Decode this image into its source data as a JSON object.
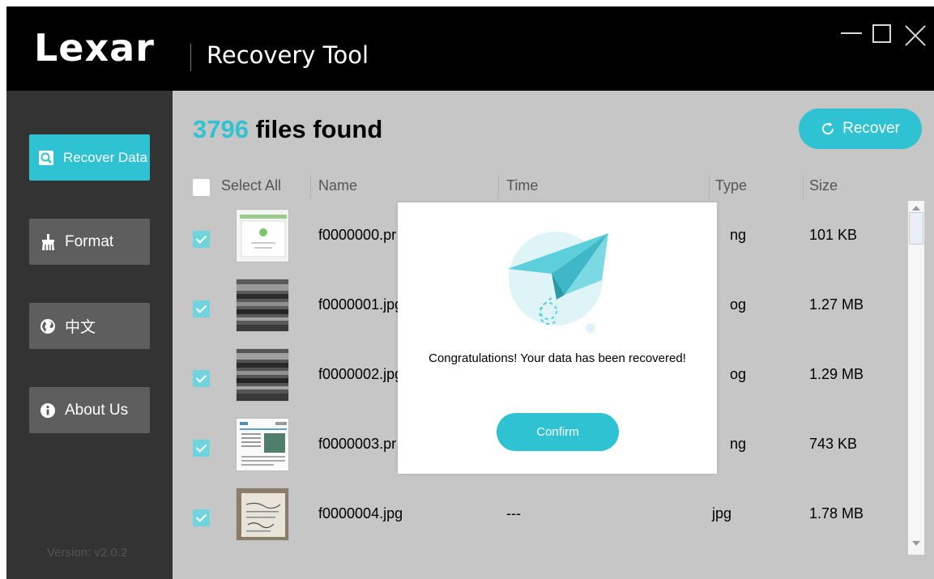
{
  "app": {
    "logo": "Lexar",
    "title": "Recovery Tool"
  },
  "sidebar": {
    "items": [
      {
        "label": "Recover Data",
        "icon": "recover-data-icon",
        "active": true
      },
      {
        "label": "Format",
        "icon": "broom-icon"
      },
      {
        "label": "中文",
        "icon": "globe-icon"
      },
      {
        "label": "About Us",
        "icon": "info-icon"
      }
    ],
    "version": "Version: v2.0.2"
  },
  "main": {
    "count": "3796",
    "found_text": " files found",
    "recover_label": "Recover",
    "columns": {
      "select_all": "Select All",
      "name": "Name",
      "time": "Time",
      "type": "Type",
      "size": "Size"
    },
    "rows": [
      {
        "name": "f0000000.pr",
        "time": "",
        "type": "ng",
        "size": "101 KB",
        "checked": true
      },
      {
        "name": "f0000001.jpg",
        "time": "",
        "type": "og",
        "size": "1.27 MB",
        "checked": true
      },
      {
        "name": "f0000002.jpg",
        "time": "",
        "type": "og",
        "size": "1.29 MB",
        "checked": true
      },
      {
        "name": "f0000003.pr",
        "time": "",
        "type": "ng",
        "size": "743 KB",
        "checked": true
      },
      {
        "name": "f0000004.jpg",
        "time": "---",
        "type": "jpg",
        "size": "1.78 MB",
        "checked": true
      }
    ]
  },
  "modal": {
    "message": "Congratulations! Your data has been recovered!",
    "confirm_label": "Confirm"
  },
  "colors": {
    "accent": "#2ec2d2",
    "sidebar_bg": "#333333",
    "titlebar_bg": "#000000",
    "content_bg": "#c6c6c6"
  }
}
